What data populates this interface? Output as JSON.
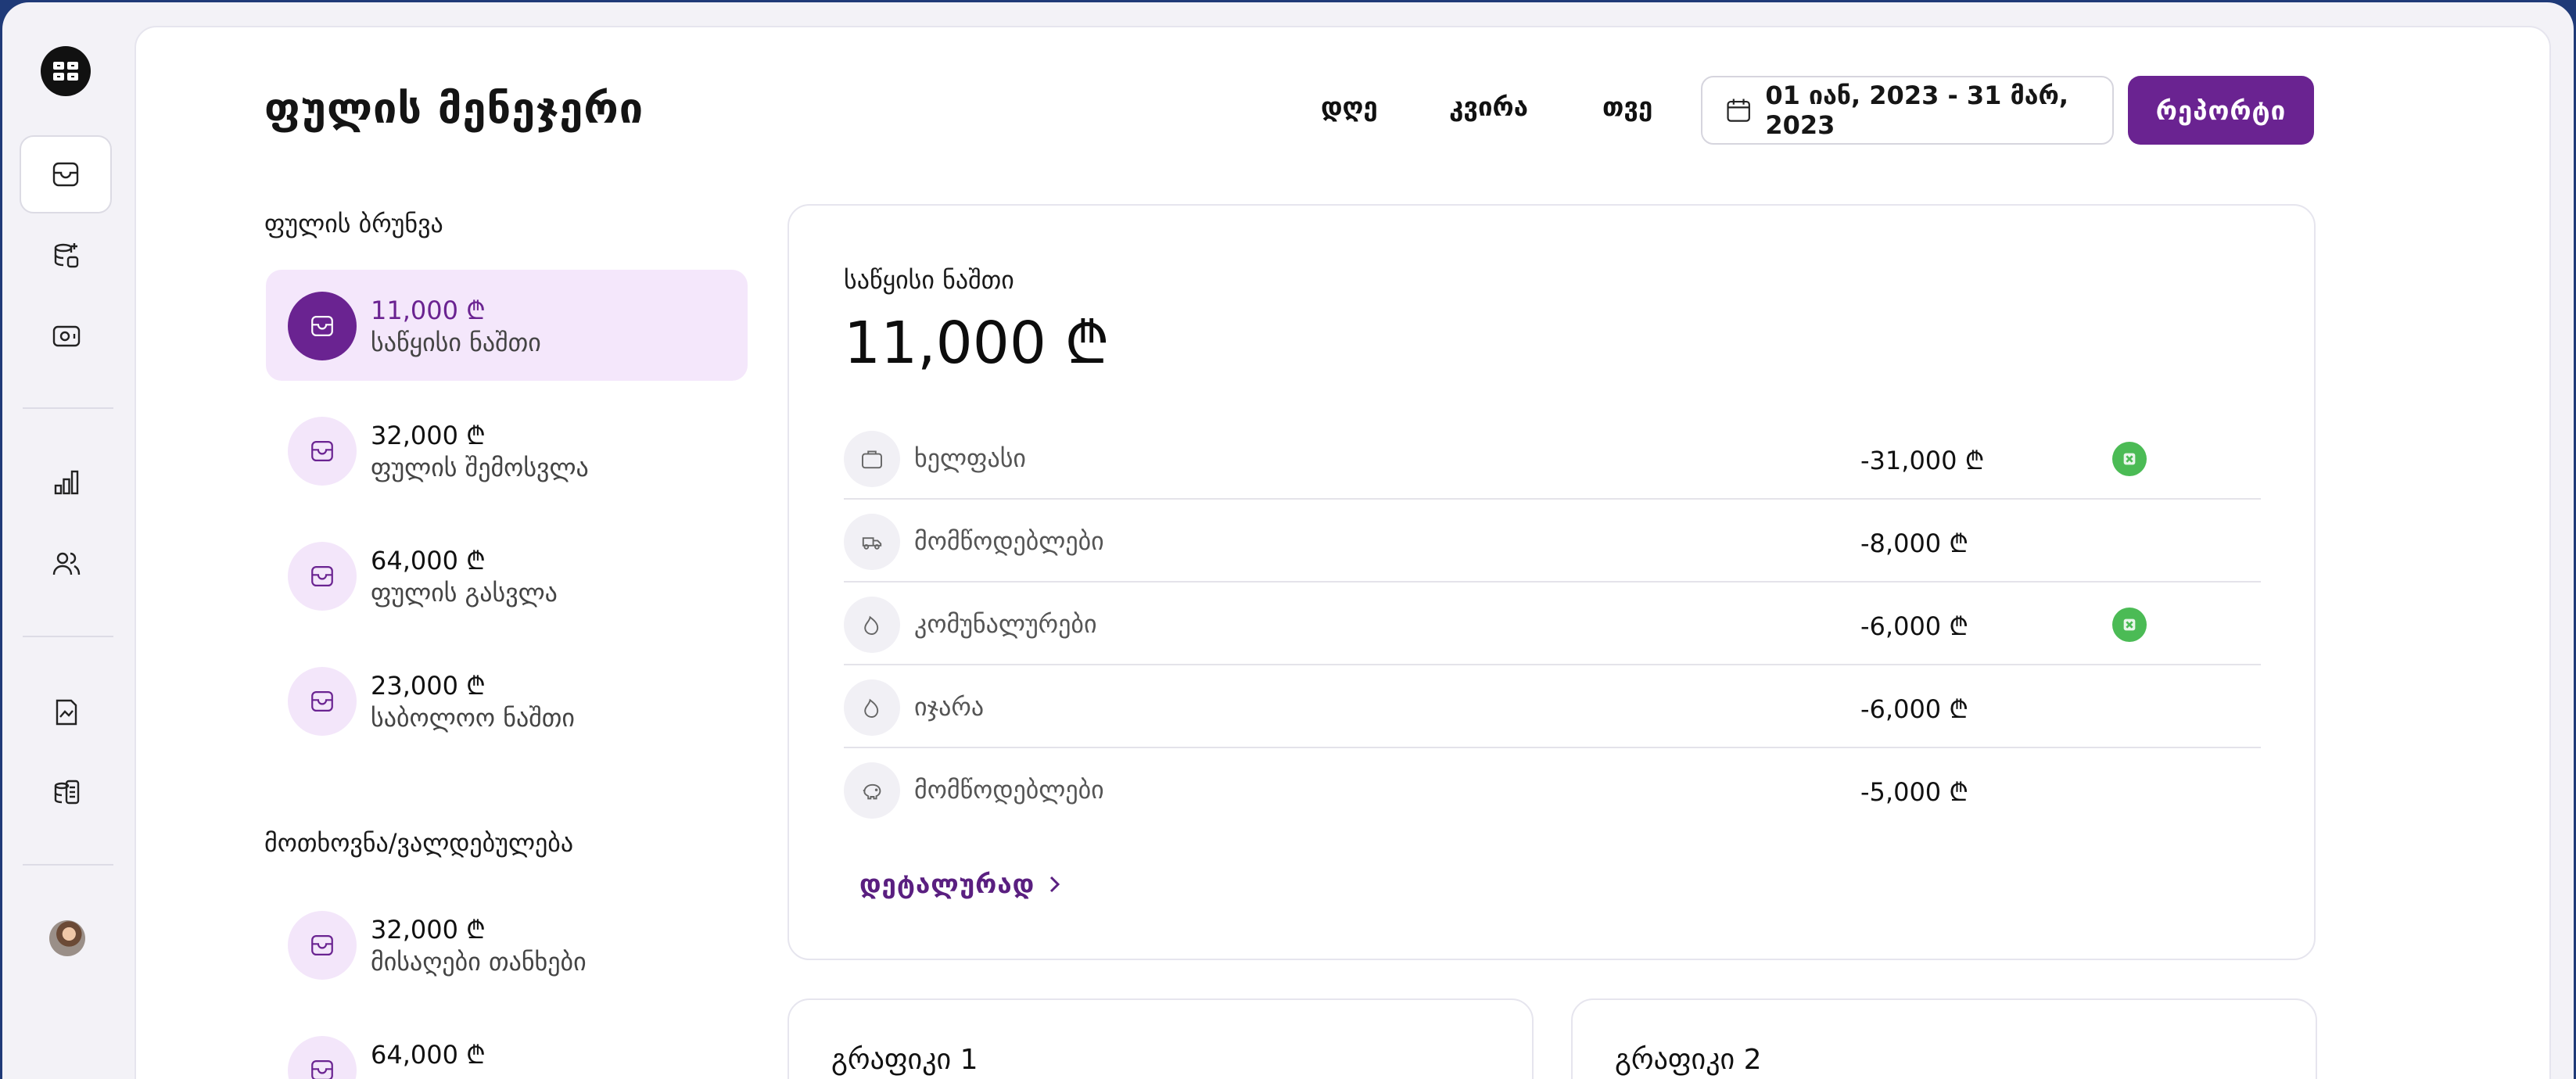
{
  "app": {
    "title": "ფულის მენეჯერი"
  },
  "header": {
    "periods": [
      "დღე",
      "კვირა",
      "თვე"
    ],
    "date_range": "01 იან, 2023 - 31 მარ, 2023",
    "report_button": "რეპორტი"
  },
  "cashflow": {
    "title": "ფულის ბრუნვა",
    "items": [
      {
        "amount": "11,000 ₾",
        "label": "საწყისი ნაშთი",
        "selected": true
      },
      {
        "amount": "32,000 ₾",
        "label": "ფულის შემოსვლა"
      },
      {
        "amount": "64,000 ₾",
        "label": "ფულის გასვლა"
      },
      {
        "amount": "23,000 ₾",
        "label": "საბოლოო ნაშთი"
      }
    ]
  },
  "obligations": {
    "title": "მოთხოვნა/ვალდებულება",
    "items": [
      {
        "amount": "32,000 ₾",
        "label": "მისაღები თანხები"
      },
      {
        "amount": "64,000 ₾",
        "label": ""
      }
    ]
  },
  "balance": {
    "label": "საწყისი ნაშთი",
    "amount": "11,000 ₾",
    "rows": [
      {
        "icon": "briefcase-icon",
        "label": "ხელფასი",
        "value": "-31,000 ₾",
        "status": "green-badge"
      },
      {
        "icon": "truck-icon",
        "label": "მომწოდებლები",
        "value": "-8,000 ₾"
      },
      {
        "icon": "flame-icon",
        "label": "კომუნალურები",
        "value": "-6,000 ₾",
        "status": "green-badge"
      },
      {
        "icon": "flame-icon",
        "label": "იჯარა",
        "value": "-6,000 ₾"
      },
      {
        "icon": "piggy-bank-icon",
        "label": "მომწოდებლები",
        "value": "-5,000 ₾"
      }
    ],
    "details_link": "დეტალურად"
  },
  "graphs": [
    {
      "title": "გრაფიკი 1"
    },
    {
      "title": "გრაფიკი 2"
    }
  ],
  "colors": {
    "accent": "#6a2391",
    "accent_light": "#f4e7fb",
    "status_green": "#4bbb55"
  }
}
